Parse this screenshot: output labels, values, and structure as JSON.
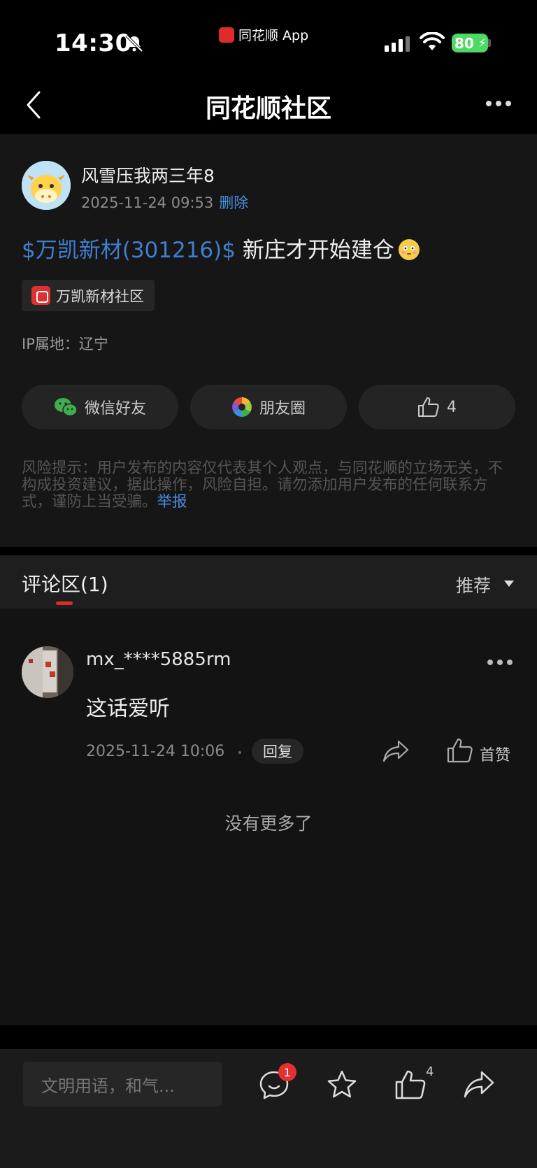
{
  "status_bar": {
    "time": "14:30",
    "app_label": "同花顺 App",
    "battery": "80"
  },
  "nav": {
    "title": "同花顺社区"
  },
  "post": {
    "author": "风雪压我两三年8",
    "time": "2025-11-24 09:53",
    "delete_label": "删除",
    "stock_link": "$万凯新材(301216)$",
    "text": " 新庄才开始建仓",
    "community_tag": "万凯新材社区",
    "ip_location": "IP属地：辽宁",
    "share_wechat": "微信好友",
    "share_moments": "朋友圈",
    "like_count": "4",
    "risk_notice": "风险提示：用户发布的内容仅代表其个人观点，与同花顺的立场无关，不构成投资建议，据此操作，风险自担。请勿添加用户发布的任何联系方式，谨防上当受骗。",
    "report_label": "举报"
  },
  "comments": {
    "title": "评论区(1)",
    "sort_label": "推荐",
    "items": [
      {
        "user": "mx_****5885rm",
        "text": "这话爱听",
        "time": "2025-11-24 10:06",
        "reply_label": "回复",
        "like_label": "首赞"
      }
    ],
    "no_more": "没有更多了"
  },
  "bottom_bar": {
    "input_placeholder": "文明用语，和气...",
    "comment_badge": "1",
    "like_count": "4"
  },
  "colors": {
    "link_blue": "#3f7fd0",
    "accent_red": "#e32a2a",
    "card_bg": "#161616",
    "page_bg": "#000000"
  },
  "icons": [
    "back-icon",
    "more-icon",
    "wechat-icon",
    "moments-icon",
    "thumbs-up-icon",
    "share-icon",
    "comment-icon",
    "star-icon"
  ]
}
